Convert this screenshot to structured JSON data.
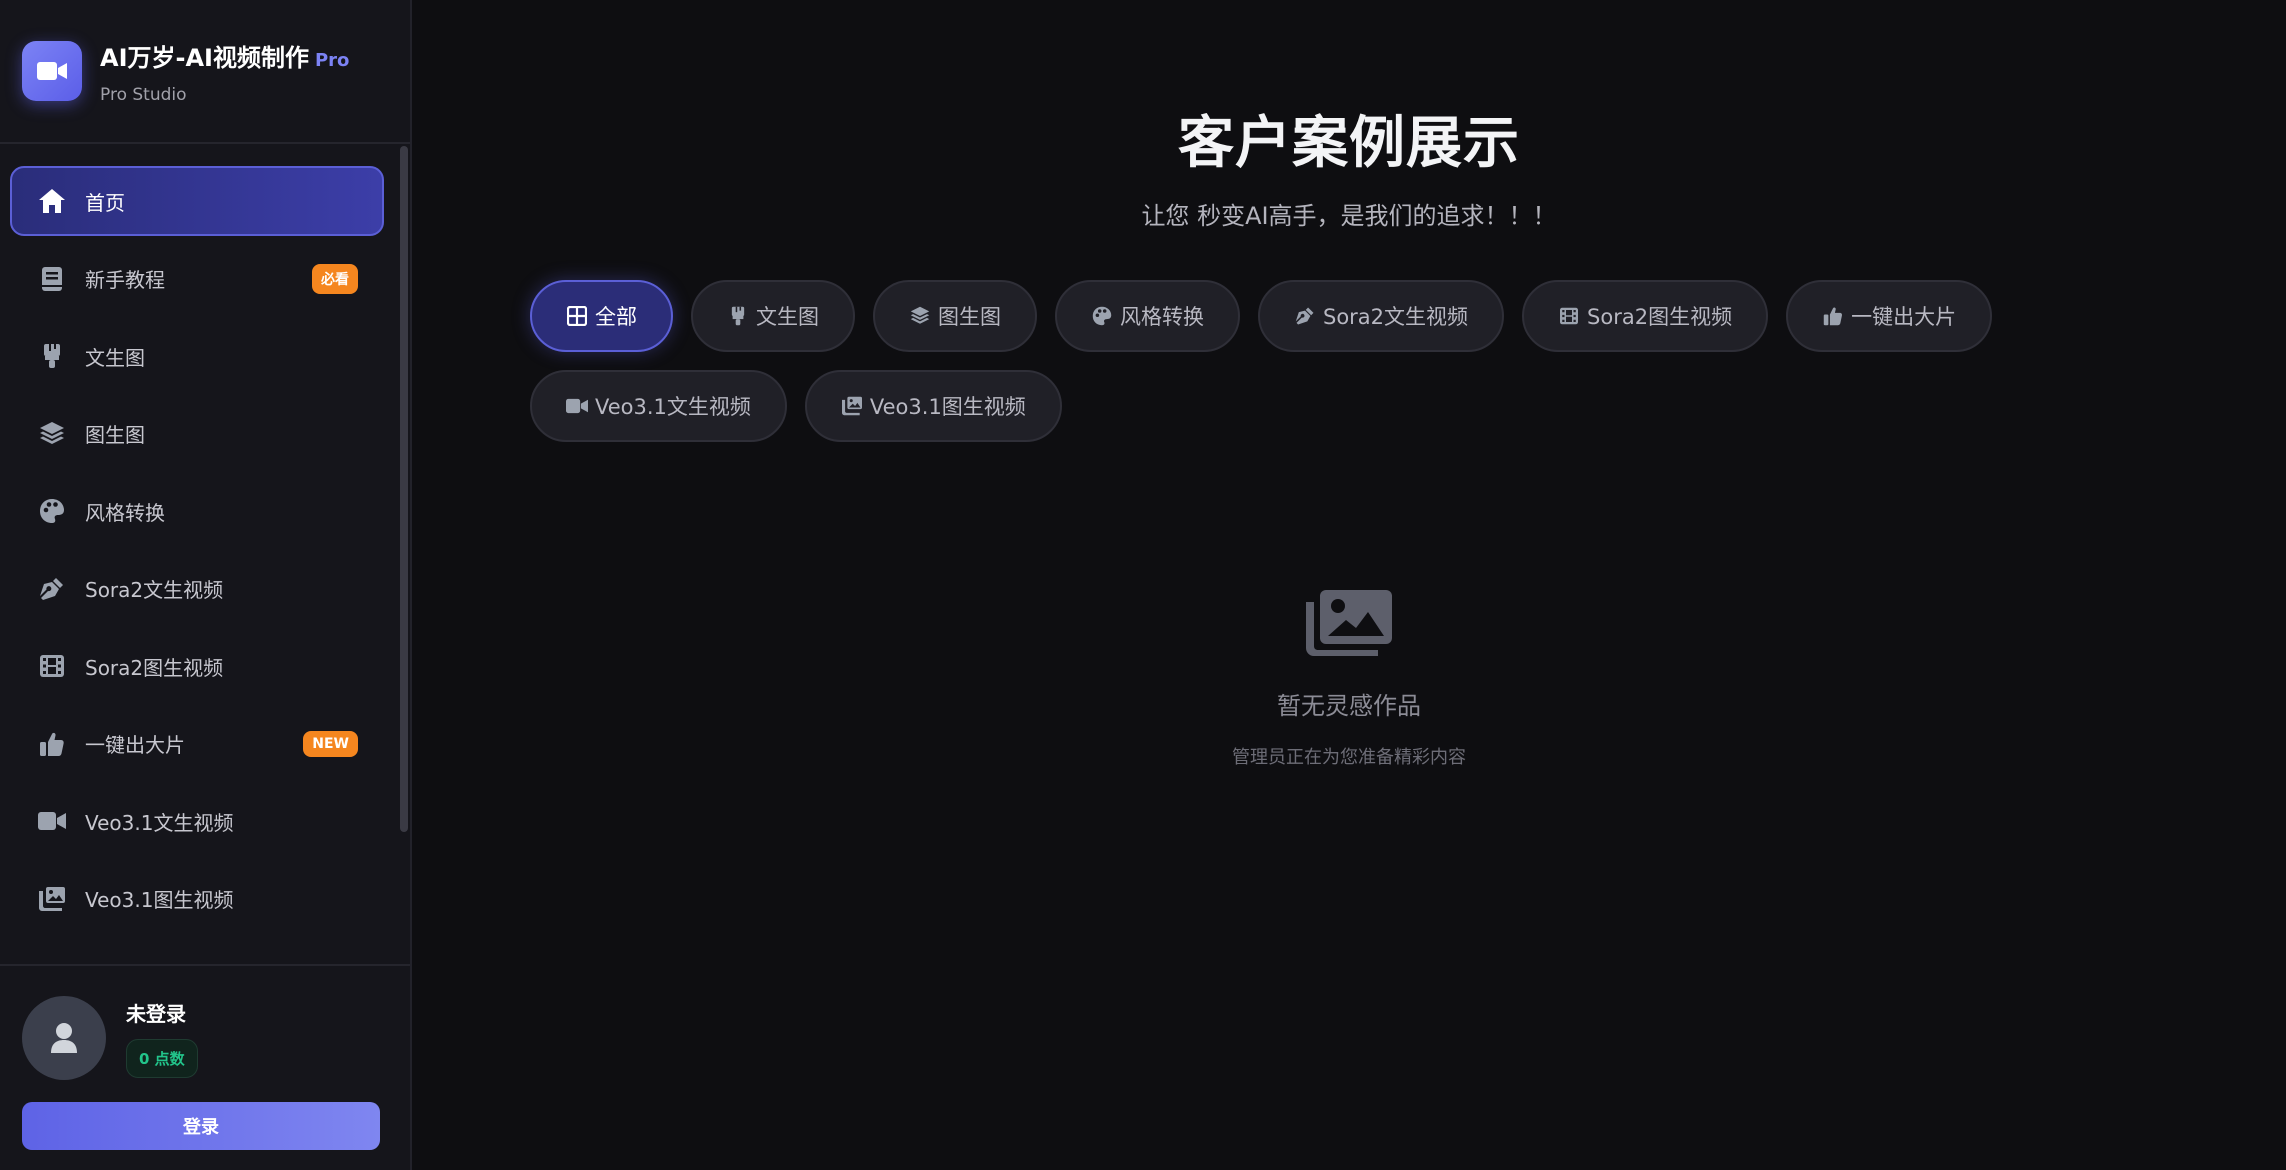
{
  "brand": {
    "title": "AI万岁-AI视频制作",
    "pro_tag": "Pro",
    "subtitle": "Pro Studio"
  },
  "sidebar": {
    "items": [
      {
        "label": "首页",
        "icon": "home-icon",
        "active": true,
        "badge": ""
      },
      {
        "label": "新手教程",
        "icon": "book-icon",
        "active": false,
        "badge": "必看"
      },
      {
        "label": "文生图",
        "icon": "paint-brush-icon",
        "active": false,
        "badge": ""
      },
      {
        "label": "图生图",
        "icon": "layers-icon",
        "active": false,
        "badge": ""
      },
      {
        "label": "风格转换",
        "icon": "palette-icon",
        "active": false,
        "badge": ""
      },
      {
        "label": "Sora2文生视频",
        "icon": "pen-nib-icon",
        "active": false,
        "badge": ""
      },
      {
        "label": "Sora2图生视频",
        "icon": "film-icon",
        "active": false,
        "badge": ""
      },
      {
        "label": "一键出大片",
        "icon": "thumbs-up-icon",
        "active": false,
        "badge": "NEW"
      },
      {
        "label": "Veo3.1文生视频",
        "icon": "video-icon",
        "active": false,
        "badge": ""
      },
      {
        "label": "Veo3.1图生视频",
        "icon": "photo-film-icon",
        "active": false,
        "badge": ""
      }
    ]
  },
  "user": {
    "name": "未登录",
    "points": "0 点数",
    "login_label": "登录"
  },
  "main": {
    "title": "客户案例展示",
    "subtitle": "让您 秒变AI高手，是我们的追求！！！",
    "filters": [
      {
        "label": "全部",
        "icon": "grid-icon",
        "active": true
      },
      {
        "label": "文生图",
        "icon": "paint-brush-icon",
        "active": false
      },
      {
        "label": "图生图",
        "icon": "layers-icon",
        "active": false
      },
      {
        "label": "风格转换",
        "icon": "palette-icon",
        "active": false
      },
      {
        "label": "Sora2文生视频",
        "icon": "pen-nib-icon",
        "active": false
      },
      {
        "label": "Sora2图生视频",
        "icon": "film-icon",
        "active": false
      },
      {
        "label": "一键出大片",
        "icon": "thumbs-up-icon",
        "active": false
      },
      {
        "label": "Veo3.1文生视频",
        "icon": "video-icon",
        "active": false
      },
      {
        "label": "Veo3.1图生视频",
        "icon": "photo-film-icon",
        "active": false
      }
    ],
    "empty_title": "暂无灵感作品",
    "empty_sub": "管理员正在为您准备精彩内容"
  },
  "colors": {
    "accent": "#5b5fd6",
    "badge": "#f5861f",
    "points": "#22c58b"
  }
}
